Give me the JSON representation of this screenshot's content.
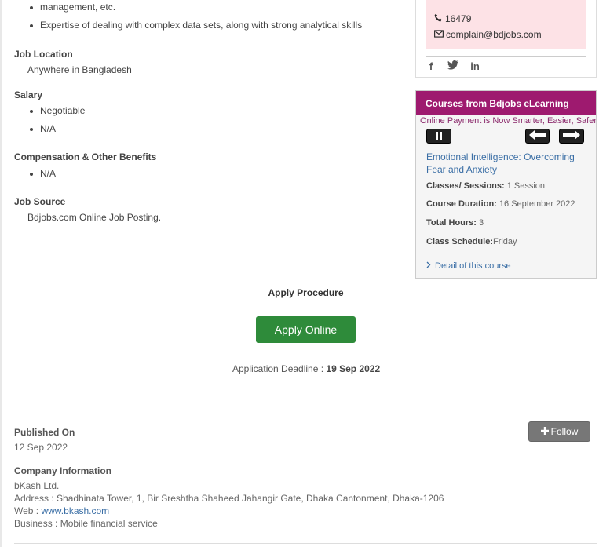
{
  "requirements": {
    "items": [
      "management, etc.",
      "Expertise of dealing with complex data sets, along with strong analytical skills"
    ]
  },
  "job_location": {
    "heading": "Job Location",
    "value": "Anywhere in Bangladesh"
  },
  "salary": {
    "heading": "Salary",
    "items": [
      "Negotiable",
      "N/A"
    ]
  },
  "compensation": {
    "heading": "Compensation & Other Benefits",
    "items": [
      "N/A"
    ]
  },
  "job_source": {
    "heading": "Job Source",
    "value": "Bdjobs.com Online Job Posting."
  },
  "contact": {
    "phone": "16479",
    "email": "complain@bdjobs.com",
    "social": [
      "facebook-icon",
      "twitter-icon",
      "linkedin-icon"
    ]
  },
  "courses": {
    "header": "Courses from Bdjobs eLearning",
    "marquee": "Online Payment is Now Smarter, Easier, Safer",
    "course_title": "Emotional Intelligence: Overcoming Fear and Anxiety",
    "classes_label": "Classes/ Sessions:",
    "classes_value": "1 Session",
    "duration_label": "Course Duration:",
    "duration_value": "16 September 2022",
    "hours_label": "Total Hours:",
    "hours_value": "3",
    "schedule_label": "Class Schedule:",
    "schedule_value": "Friday",
    "detail_link": "Detail of this course"
  },
  "apply": {
    "title": "Apply Procedure",
    "button": "Apply Online",
    "deadline_label": "Application Deadline :",
    "deadline_value": "19 Sep 2022"
  },
  "published": {
    "heading": "Published On",
    "date": "12 Sep 2022",
    "follow_button": "Follow"
  },
  "company": {
    "heading": "Company Information",
    "name": "bKash Ltd.",
    "address": "Address : Shadhinata Tower, 1, Bir Sreshtha Shaheed Jahangir Gate, Dhaka Cantonment, Dhaka-1206",
    "web_label": "Web :",
    "web_url": "www.bkash.com",
    "business": "Business : Mobile financial service"
  },
  "colors": {
    "courses_header": "#9e1a6f",
    "apply_button": "#2e8b3a",
    "link": "#3a6ea5",
    "contact_box": "#fde2e6"
  }
}
